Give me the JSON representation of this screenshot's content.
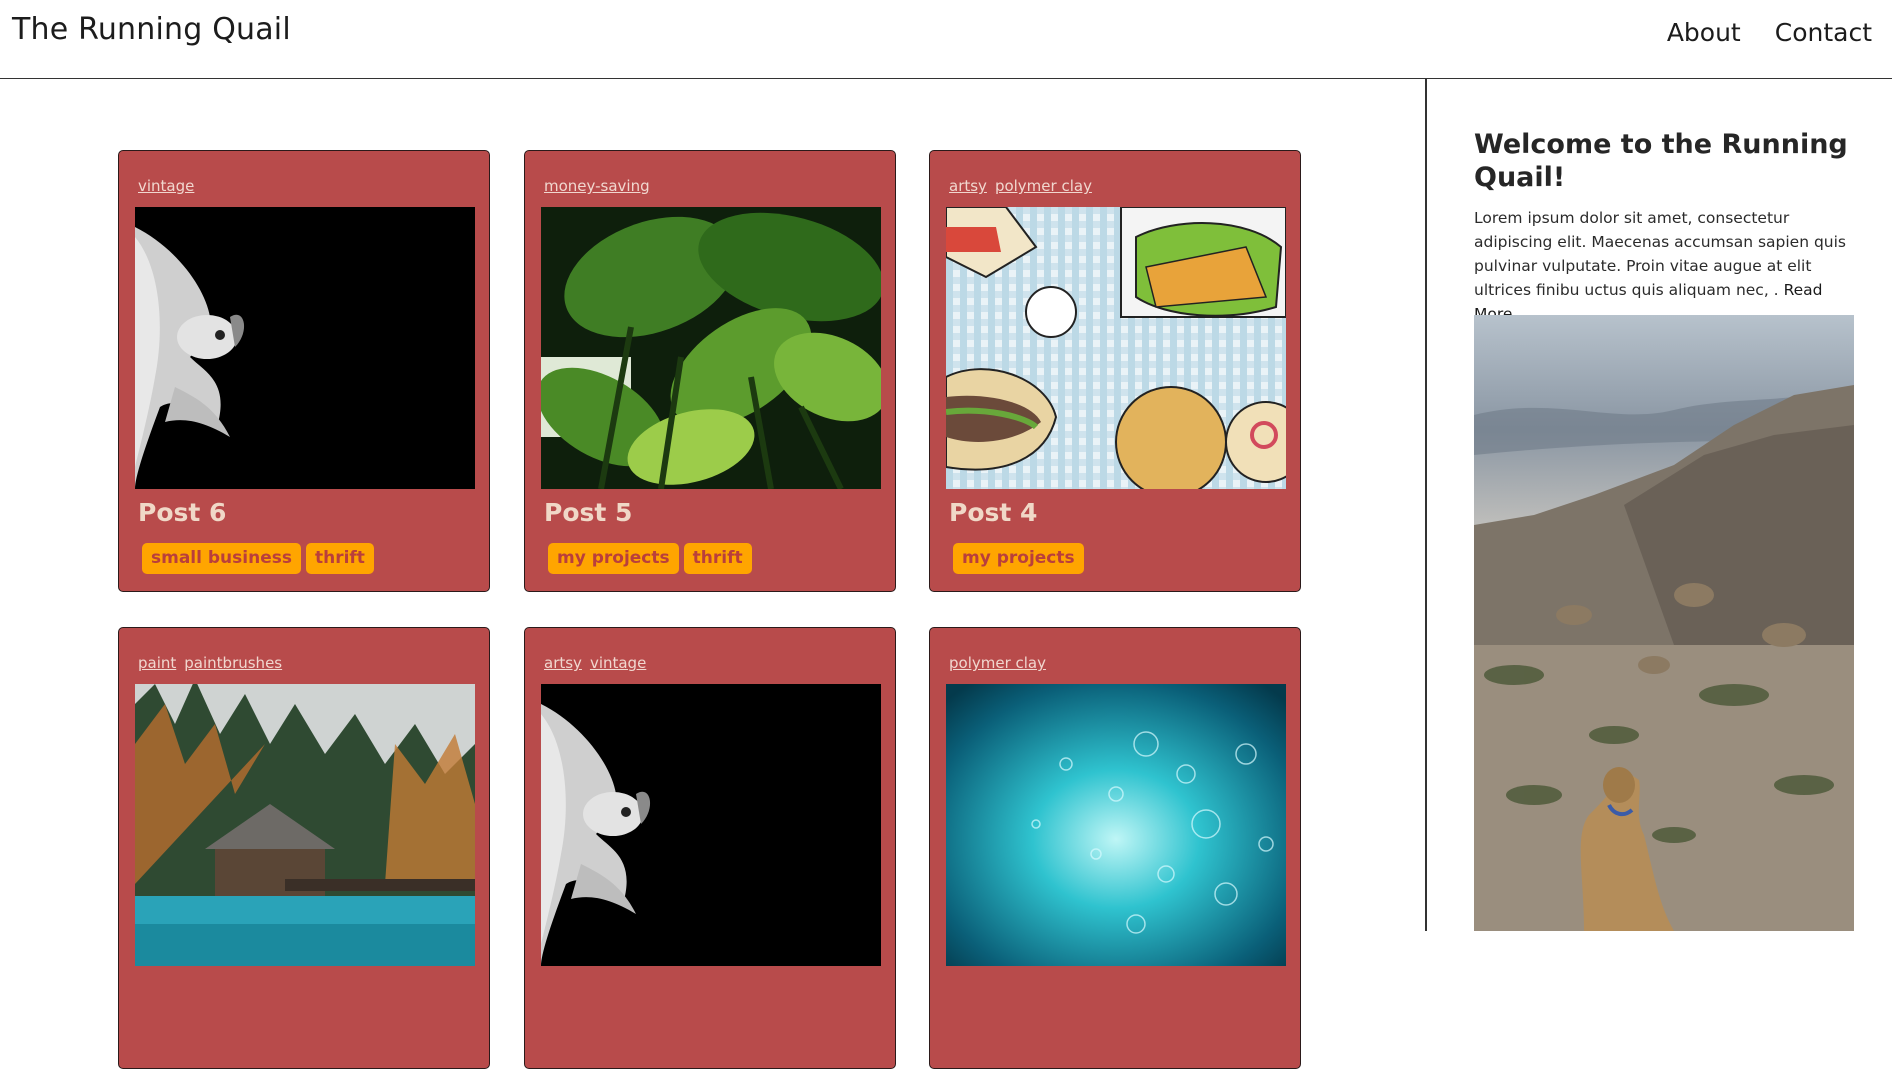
{
  "header": {
    "site_title": "The Running Quail",
    "nav": [
      {
        "label": "About"
      },
      {
        "label": "Contact"
      }
    ]
  },
  "posts": [
    {
      "title": "Post 6",
      "categories": [
        "vintage"
      ],
      "tags": [
        "small business",
        "thrift"
      ],
      "image": "betta-fish"
    },
    {
      "title": "Post 5",
      "categories": [
        "money-saving"
      ],
      "tags": [
        "my projects",
        "thrift"
      ],
      "image": "tropical-leaves"
    },
    {
      "title": "Post 4",
      "categories": [
        "artsy",
        "polymer clay"
      ],
      "tags": [
        "my projects"
      ],
      "image": "food-illustration"
    },
    {
      "title": "",
      "categories": [
        "paint",
        "paintbrushes"
      ],
      "tags": [],
      "image": "lake-cabin"
    },
    {
      "title": "",
      "categories": [
        "artsy",
        "vintage"
      ],
      "tags": [],
      "image": "betta-fish"
    },
    {
      "title": "",
      "categories": [
        "polymer clay"
      ],
      "tags": [],
      "image": "underwater-bubbles"
    }
  ],
  "sidebar": {
    "heading": "Welcome to the Running Quail!",
    "body": "Lorem ipsum dolor sit amet, consectetur adipiscing elit. Maecenas accumsan sapien quis pulvinar vulputate. Proin vitae augue at elit ultrices finibu uctus quis aliquam nec, .",
    "read_more": "Read More…",
    "photo": "desert-dog"
  },
  "colors": {
    "card_bg": "#b84b4b",
    "tag_bg": "#ffa500",
    "tag_text": "#b93f3c",
    "title_text": "#f0d8c7"
  }
}
